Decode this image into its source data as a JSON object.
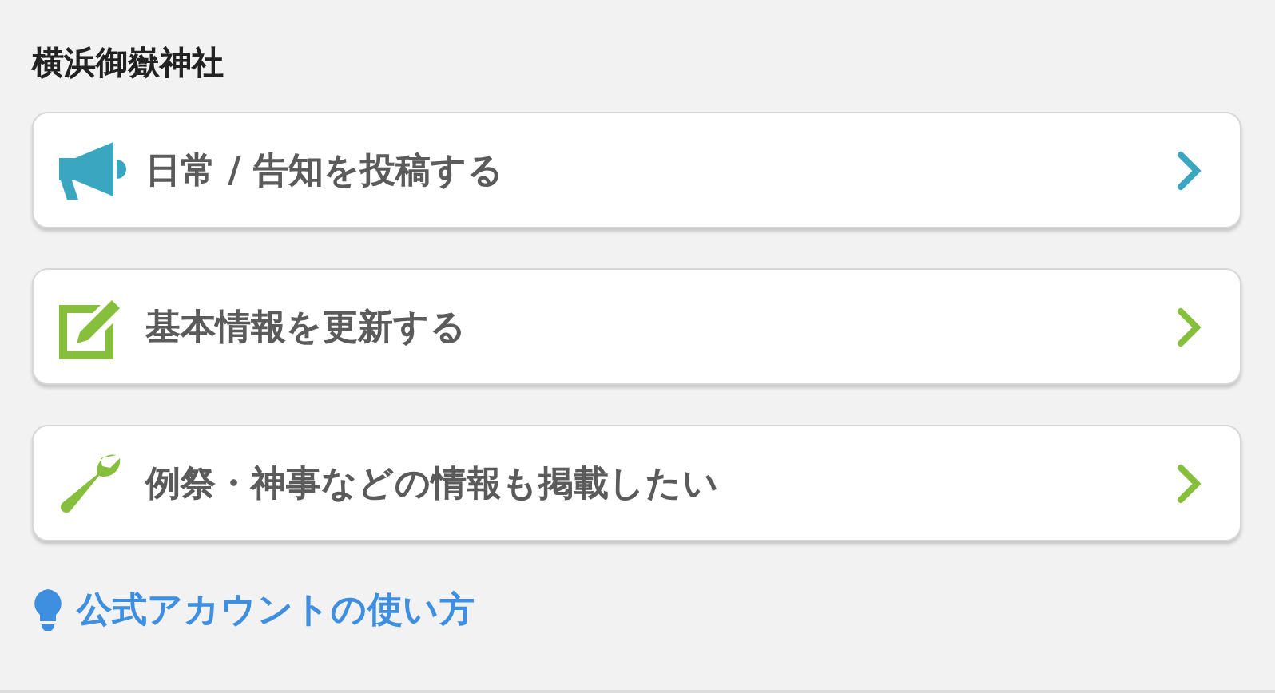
{
  "heading": "横浜御嶽神社",
  "actions": [
    {
      "kind": "megaphone",
      "label": "日常 / 告知を投稿する",
      "color": "#3aa6c0"
    },
    {
      "kind": "edit",
      "label": "基本情報を更新する",
      "color": "#86bf3c"
    },
    {
      "kind": "wrench",
      "label": "例祭・神事などの情報も掲載したい",
      "color": "#86bf3c"
    }
  ],
  "help_link": "公式アカウントの使い方"
}
